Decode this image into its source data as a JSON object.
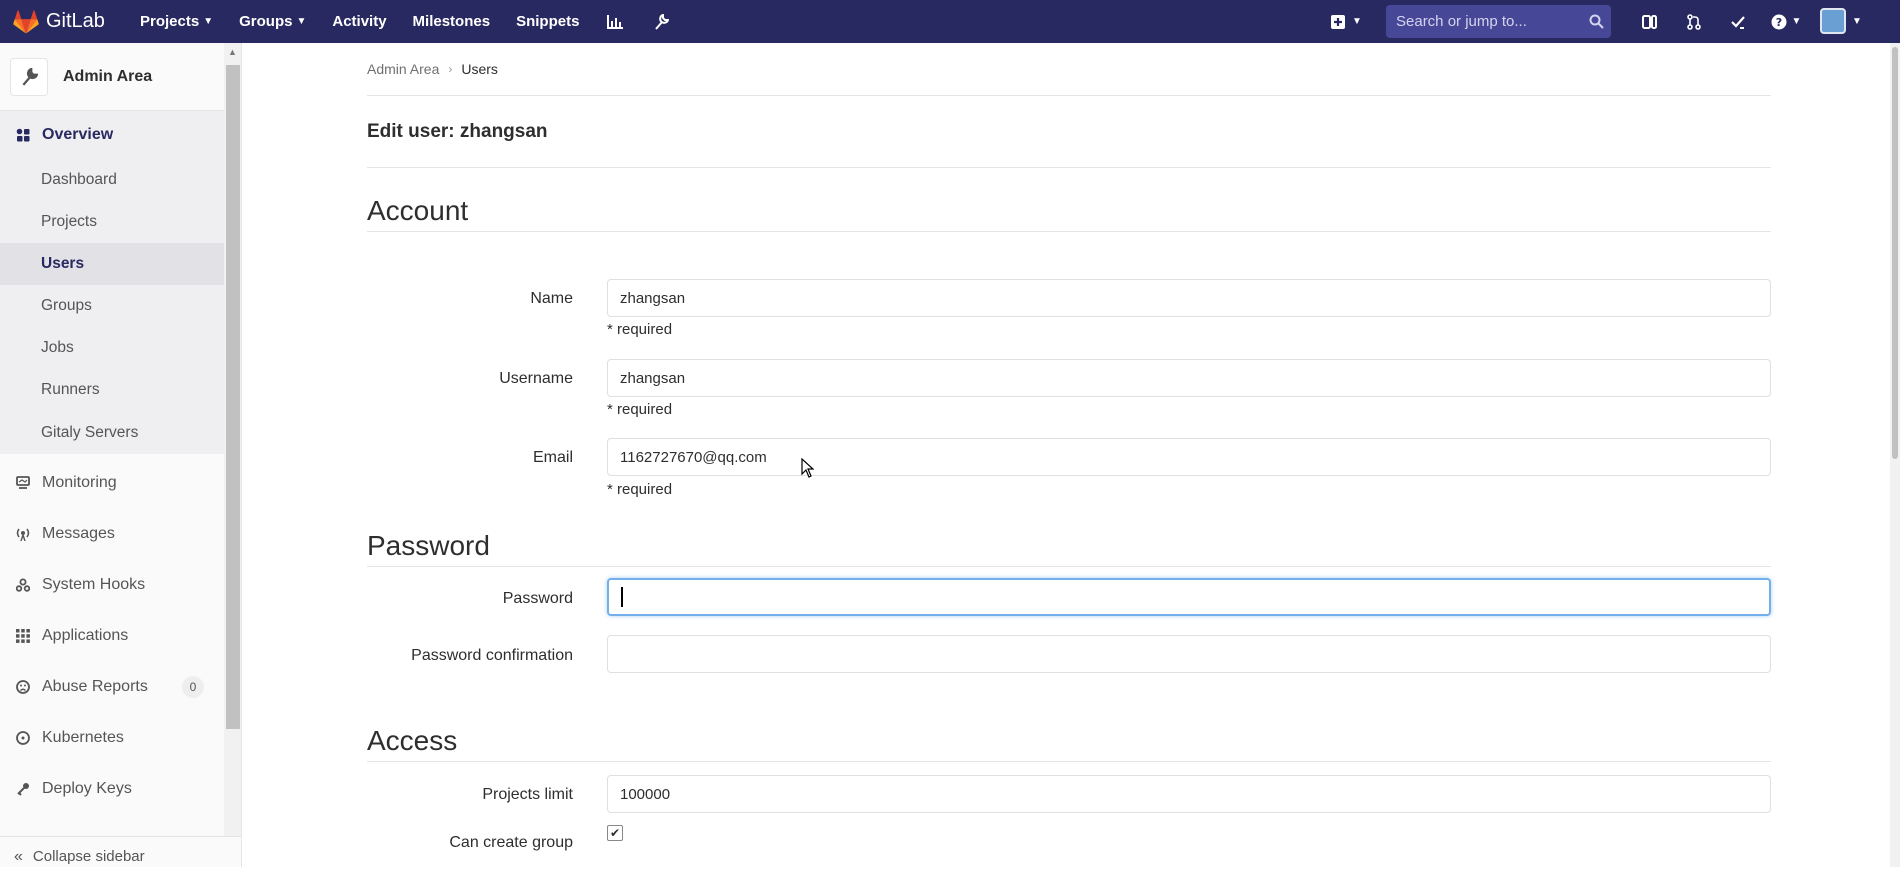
{
  "navbar": {
    "brand": "GitLab",
    "links": [
      {
        "label": "Projects",
        "dropdown": true
      },
      {
        "label": "Groups",
        "dropdown": true
      },
      {
        "label": "Activity",
        "dropdown": false
      },
      {
        "label": "Milestones",
        "dropdown": false
      },
      {
        "label": "Snippets",
        "dropdown": false
      }
    ],
    "chart_icon": "chart-icon",
    "admin_icon": "wrench-icon",
    "search_placeholder": "Search or jump to...",
    "right_icons": [
      "issues-icon",
      "merge-request-icon",
      "todo-icon",
      "help-icon"
    ],
    "colors": {
      "bar": "#292961",
      "search": "#474798"
    }
  },
  "sidebar": {
    "title": "Admin Area",
    "overview_label": "Overview",
    "sub_items": [
      "Dashboard",
      "Projects",
      "Users",
      "Groups",
      "Jobs",
      "Runners",
      "Gitaly Servers"
    ],
    "active_sub": "Users",
    "items": [
      {
        "label": "Monitoring",
        "icon": "monitor-icon"
      },
      {
        "label": "Messages",
        "icon": "broadcast-icon"
      },
      {
        "label": "System Hooks",
        "icon": "hook-icon"
      },
      {
        "label": "Applications",
        "icon": "apps-icon"
      },
      {
        "label": "Abuse Reports",
        "icon": "abuse-icon",
        "count": "0"
      },
      {
        "label": "Kubernetes",
        "icon": "kubernetes-icon"
      },
      {
        "label": "Deploy Keys",
        "icon": "key-icon"
      }
    ],
    "collapse_label": "Collapse sidebar"
  },
  "breadcrumb": {
    "root": "Admin Area",
    "current": "Users"
  },
  "page": {
    "title": "Edit user: zhangsan"
  },
  "account": {
    "title": "Account",
    "name_label": "Name",
    "name_value": "zhangsan",
    "username_label": "Username",
    "username_value": "zhangsan",
    "email_label": "Email",
    "email_value": "1162727670@qq.com",
    "required_text": "* required"
  },
  "password": {
    "title": "Password",
    "password_label": "Password",
    "password_value": "",
    "confirm_label": "Password confirmation",
    "confirm_value": ""
  },
  "access": {
    "title": "Access",
    "projects_limit_label": "Projects limit",
    "projects_limit_value": "100000",
    "can_create_group_label": "Can create group",
    "can_create_group_checked": true
  }
}
